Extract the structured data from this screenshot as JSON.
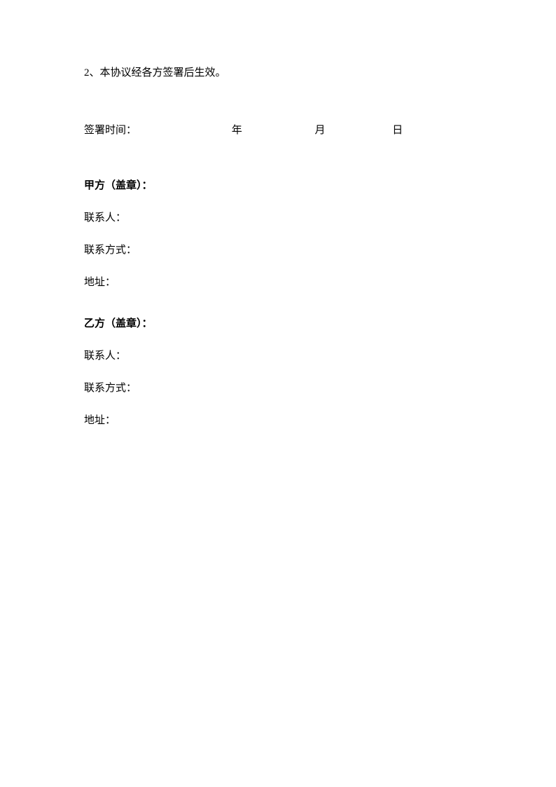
{
  "clause": "2、本协议经各方签署后生效。",
  "signingDate": {
    "label": "签署时间：",
    "year": "年",
    "month": "月",
    "day": "日"
  },
  "partyA": {
    "header": "甲方（盖章）：",
    "contactPerson": "联系人：",
    "contactMethod": "联系方式：",
    "address": "地址："
  },
  "partyB": {
    "header": "乙方（盖章）：",
    "contactPerson": "联系人：",
    "contactMethod": "联系方式：",
    "address": "地址："
  }
}
